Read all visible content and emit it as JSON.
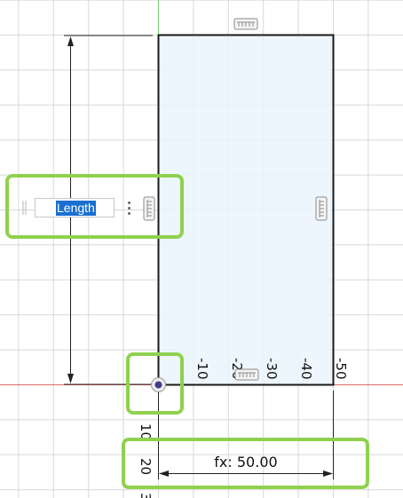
{
  "sketch": {
    "horizontal_ruler_ticks": [
      "-10",
      "-20",
      "-30",
      "-40",
      "-50"
    ],
    "vertical_ruler_ticks": [
      "10",
      "20",
      "3"
    ]
  },
  "dimensions": {
    "length_input": {
      "value": "Length",
      "selected": true
    },
    "width_dimension": {
      "label": "fx: 50.00"
    }
  },
  "colors": {
    "grid_line": "#d8d8d8",
    "x_axis": "#e06666",
    "y_axis": "#7bd27b",
    "rectangle_fill": "#eaf4fd",
    "rectangle_stroke": "#1a1a1a",
    "highlight": "#8fd14f",
    "selection": "#1a6fd1"
  },
  "icons": {
    "constraint_top": "horizontal-constraint-icon",
    "constraint_right": "vertical-constraint-icon",
    "constraint_bottom": "horizontal-constraint-icon",
    "constraint_input": "vertical-constraint-icon",
    "origin": "origin-point-icon",
    "input_menu": "more-options-icon"
  }
}
